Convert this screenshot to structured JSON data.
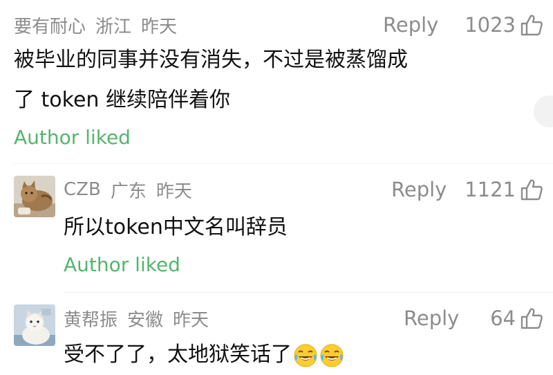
{
  "colors": {
    "meta_text": "#8c8c8c",
    "body_text": "#111111",
    "author_liked": "#52b66a",
    "background": "#ffffff"
  },
  "comments": [
    {
      "username": "要有耐心",
      "location": "浙江",
      "time": "昨天",
      "reply_label": "Reply",
      "likes": "1023",
      "text_line1": "被毕业的同事并没有消失，不过是被蒸馏成",
      "text_line2": "了 token 继续陪伴着你",
      "author_liked": "Author liked",
      "like_icon": "thumbs-up-icon"
    },
    {
      "username": "CZB",
      "location": "广东",
      "time": "昨天",
      "reply_label": "Reply",
      "likes": "1121",
      "text": "所以token中文名叫辞员",
      "author_liked": "Author liked",
      "avatar": "cat-photo-avatar",
      "like_icon": "thumbs-up-icon"
    },
    {
      "username": "黄帮振",
      "location": "安徽",
      "time": "昨天",
      "reply_label": "Reply",
      "likes": "64",
      "text": "受不了了，太地狱笑话了",
      "emojis": [
        "tears-of-joy-emoji",
        "tears-of-joy-emoji"
      ],
      "avatar": "cat-photo-avatar",
      "like_icon": "thumbs-up-icon"
    }
  ]
}
